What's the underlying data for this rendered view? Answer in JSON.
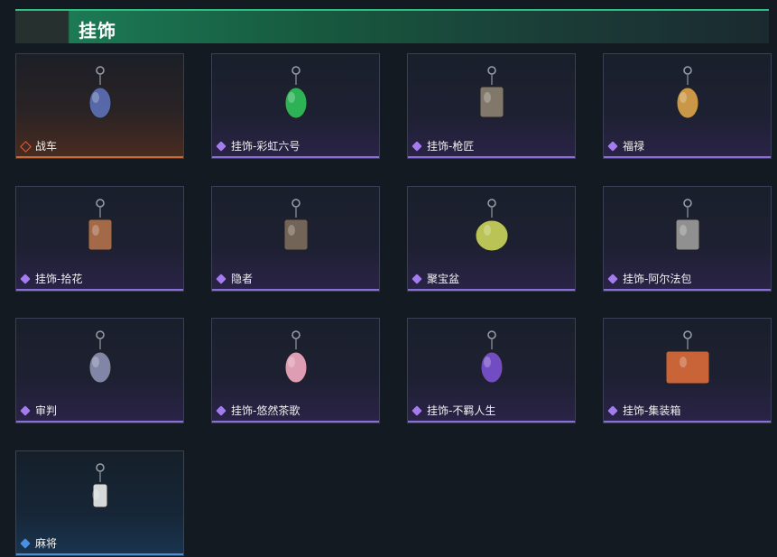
{
  "header": {
    "title": "挂饰"
  },
  "items": [
    {
      "name": "战车",
      "rarity": "orange",
      "icon": "tank-charm-icon",
      "color": "#5b6fb5"
    },
    {
      "name": "挂饰-彩虹六号",
      "rarity": "purple",
      "icon": "rainbow-six-charm-icon",
      "color": "#2fbf5a"
    },
    {
      "name": "挂饰-枪匠",
      "rarity": "purple",
      "icon": "gunsmith-vest-charm-icon",
      "color": "#8a8070"
    },
    {
      "name": "福禄",
      "rarity": "purple",
      "icon": "gourd-charm-icon",
      "color": "#d9a24a"
    },
    {
      "name": "挂饰-拾花",
      "rarity": "purple",
      "icon": "card-charm-icon",
      "color": "#b0704a"
    },
    {
      "name": "隐者",
      "rarity": "purple",
      "icon": "hermit-charm-icon",
      "color": "#7a6a5a"
    },
    {
      "name": "聚宝盆",
      "rarity": "purple",
      "icon": "treasure-bowl-charm-icon",
      "color": "#c8d25a"
    },
    {
      "name": "挂饰-阿尔法包",
      "rarity": "purple",
      "icon": "alpha-pack-charm-icon",
      "color": "#9a9a9a"
    },
    {
      "name": "审判",
      "rarity": "purple",
      "icon": "judge-charm-icon",
      "color": "#8a8fb0"
    },
    {
      "name": "挂饰-悠然茶歌",
      "rarity": "purple",
      "icon": "cupcake-charm-icon",
      "color": "#f0a8c0"
    },
    {
      "name": "挂饰-不羁人生",
      "rarity": "purple",
      "icon": "sneaker-charm-icon",
      "color": "#7a50d0"
    },
    {
      "name": "挂饰-集装箱",
      "rarity": "purple",
      "icon": "container-charm-icon",
      "color": "#d86a3a"
    },
    {
      "name": "麻将",
      "rarity": "blue",
      "icon": "mahjong-tile-charm-icon",
      "color": "#e8e8e8"
    }
  ]
}
